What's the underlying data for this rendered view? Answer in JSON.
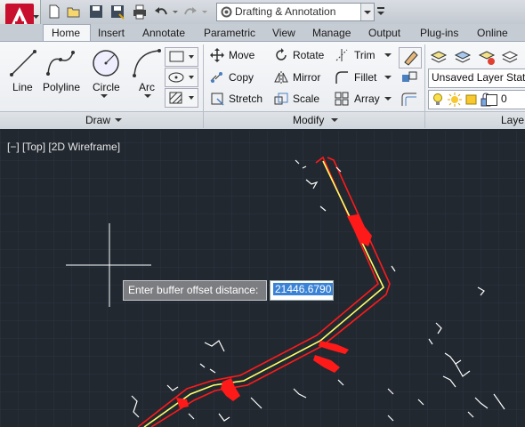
{
  "workspace": {
    "name": "Drafting & Annotation"
  },
  "tabs": [
    "Home",
    "Insert",
    "Annotate",
    "Parametric",
    "View",
    "Manage",
    "Output",
    "Plug-ins",
    "Online"
  ],
  "draw_panel": {
    "line": "Line",
    "polyline": "Polyline",
    "circle": "Circle",
    "arc": "Arc",
    "title": "Draw"
  },
  "modify_panel": {
    "move": "Move",
    "rotate": "Rotate",
    "trim": "Trim",
    "copy": "Copy",
    "mirror": "Mirror",
    "fillet": "Fillet",
    "stretch": "Stretch",
    "scale": "Scale",
    "array": "Array",
    "title": "Modify"
  },
  "layers_panel": {
    "layer_state": "Unsaved Layer State",
    "current_layer": "0",
    "title": "Laye"
  },
  "viewport": {
    "label": "[−] [Top] [2D Wireframe]"
  },
  "command": {
    "prompt": "Enter buffer offset distance:",
    "value": "21446.6790"
  },
  "colors": {
    "canvas": "#212830",
    "buffer": "#ff1a1a",
    "centerline": "#ffff66",
    "crosshair": "#ffffff",
    "input_highlight": "#3a82d6"
  }
}
